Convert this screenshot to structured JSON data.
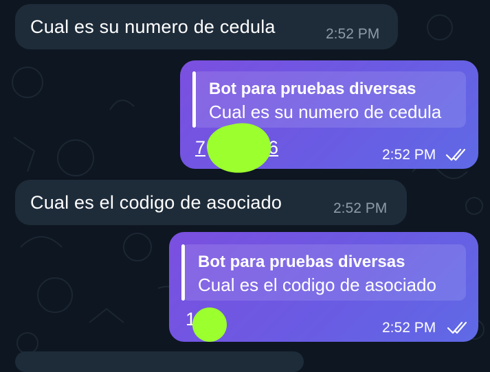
{
  "colors": {
    "background": "#0e1621",
    "incoming_bubble": "#1e2c3a",
    "outgoing_start": "#7b4fe0",
    "outgoing_end": "#5f6ae6",
    "redaction": "#9cff2e"
  },
  "messages": [
    {
      "direction": "incoming",
      "text": "Cual es su numero de cedula",
      "time": "2:52 PM"
    },
    {
      "direction": "outgoing",
      "reply_to": {
        "name": "Bot para pruebas diversas",
        "text": "Cual es su numero de cedula"
      },
      "text_start": "7",
      "text_end": "6",
      "time": "2:52 PM",
      "status_icon": "double-check-icon"
    },
    {
      "direction": "incoming",
      "text": "Cual es el codigo de asociado",
      "time": "2:52 PM"
    },
    {
      "direction": "outgoing",
      "reply_to": {
        "name": "Bot para pruebas diversas",
        "text": "Cual es el codigo de asociado"
      },
      "text_start": "1",
      "time": "2:52 PM",
      "status_icon": "double-check-icon"
    }
  ]
}
